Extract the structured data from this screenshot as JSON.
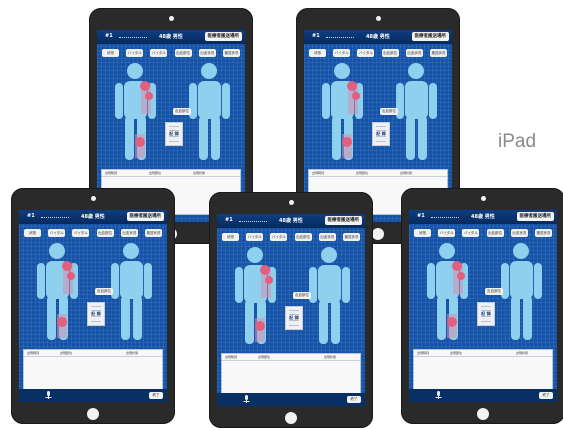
{
  "platform_label": "iPad",
  "tabs": [
    "状態",
    "バイタル",
    "バイタル",
    "出血部位",
    "出血状況",
    "搬送状況"
  ],
  "location_button": "出血部位",
  "document_text": "記 録",
  "devices": [
    {
      "patient_id": "#1",
      "patient_info": "48歳 男性",
      "header_button": "医療者搬送場所",
      "columns": [
        "出現時刻",
        "出現部位",
        "出現状態"
      ],
      "show_footer": false
    },
    {
      "patient_id": "#1",
      "patient_info": "48歳 男性",
      "header_button": "医療者搬送場所",
      "columns": [
        "出現時刻",
        "出現部位",
        "出現状態"
      ],
      "show_footer": false
    },
    {
      "patient_id": "#1",
      "patient_info": "48歳 男性",
      "header_button": "医療者搬送場所",
      "columns": [
        "出現時刻",
        "出現部位",
        "",
        "出現状態"
      ],
      "show_footer": true,
      "footer_button": "終了"
    },
    {
      "patient_id": "#1",
      "patient_info": "48歳 男性",
      "header_button": "医療者搬送場所",
      "columns": [
        "出現時刻",
        "出現部位",
        "",
        "出現状態"
      ],
      "show_footer": true,
      "footer_button": "終了"
    },
    {
      "patient_id": "#1",
      "patient_info": "48歳 男性",
      "header_button": "医療者搬送場所",
      "columns": [
        "出現時刻",
        "出現部位",
        "",
        "出現状態"
      ],
      "show_footer": true,
      "footer_button": "終了"
    }
  ],
  "colors": {
    "screen_blue": "#1553a8",
    "figure_blue": "#8fd0ee",
    "marker_red": "#e0607e",
    "bezel": "#2a2a2a"
  }
}
